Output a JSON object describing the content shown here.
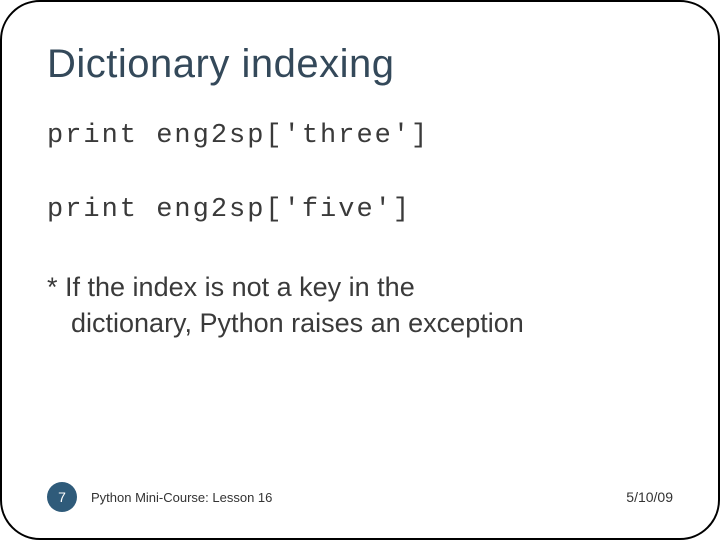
{
  "title": "Dictionary indexing",
  "code_lines": {
    "line1": "print eng2sp['three']",
    "line2": "print eng2sp['five']"
  },
  "note": {
    "prefix": "* If the index is not a key in the",
    "rest": "dictionary, Python raises an exception"
  },
  "footer": {
    "page": "7",
    "course": "Python Mini-Course: Lesson 16",
    "date": "5/10/09"
  }
}
